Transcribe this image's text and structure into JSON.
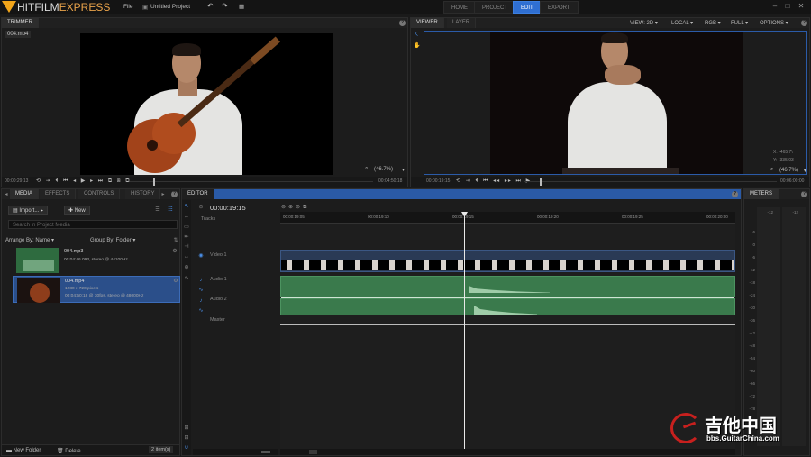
{
  "app": {
    "brand_a": "HITFILM",
    "brand_b": "EXPRESS",
    "menu_file": "File",
    "project_label": "Untitled Project"
  },
  "nav": {
    "home": "HOME",
    "project": "PROJECT",
    "edit": "EDIT",
    "export": "EXPORT"
  },
  "trimmer": {
    "tab": "TRIMMER",
    "clip": "004.mp4",
    "zoom": "(46.7%)",
    "tc_left": "00:00:29:13",
    "tc_right": "00:04:50:18"
  },
  "viewer": {
    "tab": "VIEWER",
    "tab2": "LAYER",
    "view": "VIEW: 2D",
    "local": "LOCAL",
    "rgb": "RGB",
    "full": "FULL",
    "options": "OPTIONS",
    "x_label": "X:",
    "x_val": "-465.7\\",
    "y_label": "Y:",
    "y_val": "-335.03",
    "zoom": "(46.7%)",
    "tc_left": "00:00:19:15",
    "tc_right": "00:06:00:00"
  },
  "media": {
    "tabs": [
      "MEDIA",
      "EFFECTS",
      "CONTROLS",
      "HISTORY"
    ],
    "import": "Import...",
    "new": "New",
    "search_placeholder": "Search in Project Media",
    "arrange": "Arrange By: Name",
    "group": "Group By: Folder",
    "items": [
      {
        "name": "004.mp3",
        "info1": "00:04:46.093, stereo @ 44100Hz",
        "info2": ""
      },
      {
        "name": "004.mp4",
        "info1": "1280 x 720 pixels",
        "info2": "00:04:50:18 @ 30fps, stereo @ 48000Hz"
      }
    ],
    "new_folder": "New Folder",
    "delete": "Delete",
    "count": "2 item(s)"
  },
  "editor": {
    "tab": "EDITOR",
    "timecode": "00:00:19:15",
    "tracks_label": "Tracks",
    "ruler": [
      "00:00:19:05",
      "00:00:19:10",
      "00:00:19:15",
      "00:00:19:20",
      "00:00:19:25",
      "00:00:20:00"
    ],
    "tracks": {
      "video1": "Video 1",
      "audio1": "Audio 1",
      "audio2": "Audio 2",
      "master": "Master"
    }
  },
  "meters": {
    "tab": "METERS",
    "top": [
      "-12",
      "-12"
    ],
    "scale": [
      "6",
      "0",
      "-6",
      "-12",
      "-18",
      "-24",
      "-30",
      "-36",
      "-42",
      "-48",
      "-54",
      "-60",
      "-66",
      "-72",
      "-78"
    ]
  },
  "watermark": {
    "cn": "吉他中国",
    "url": "bbs.GuitarChina.com"
  },
  "colors": {
    "accent": "#2f6fd2",
    "audio_clip": "#3a7a4c",
    "brand": "#f2a51a"
  }
}
